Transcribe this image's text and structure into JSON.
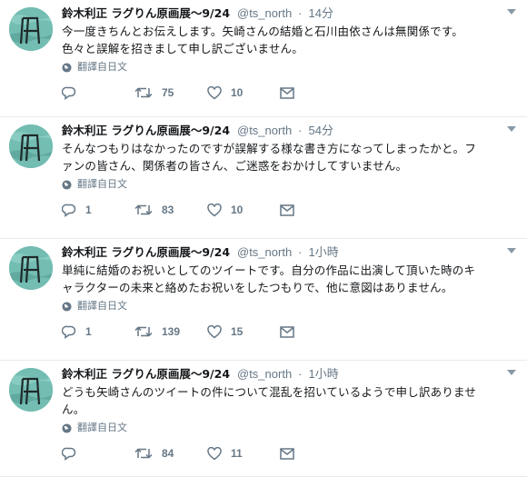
{
  "author": {
    "name": "鈴木利正 ラグりん原画展～9/24",
    "handle": "@ts_north",
    "dot": "·"
  },
  "translate_label": "翻譯自日文",
  "tweets": [
    {
      "time": "14分",
      "lines": [
        "今一度きちんとお伝えします。矢崎さんの結婚と石川由依さんは無関係です。",
        "色々と誤解を招きまして申し訳ございません。"
      ],
      "replies": "",
      "retweets": "75",
      "likes": "10"
    },
    {
      "time": "54分",
      "lines": [
        "そんなつもりはなかったのですが誤解する様な書き方になってしまったかと。フ",
        "ァンの皆さん、関係者の皆さん、ご迷惑をおかけしてすいません。"
      ],
      "replies": "1",
      "retweets": "83",
      "likes": "10"
    },
    {
      "time": "1小時",
      "lines": [
        "単純に結婚のお祝いとしてのツイートです。自分の作品に出演して頂いた時のキ",
        "ャラクターの未来と絡めたお祝いをしたつもりで、他に意図はありません。"
      ],
      "replies": "1",
      "retweets": "139",
      "likes": "15"
    },
    {
      "time": "1小時",
      "lines": [
        "どうも矢崎さんのツイートの件について混乱を招いているようで申し訳ありませ",
        "ん。"
      ],
      "replies": "",
      "retweets": "84",
      "likes": "11"
    }
  ],
  "icons": {
    "reply": "reply-icon",
    "retweet": "retweet-icon",
    "like": "heart-icon",
    "message": "message-icon",
    "globe": "globe-icon",
    "caret": "chevron-down-icon"
  },
  "colors": {
    "avatar_bg": "#6fb8ae",
    "muted": "#657786",
    "divider": "#e6ecf0"
  }
}
